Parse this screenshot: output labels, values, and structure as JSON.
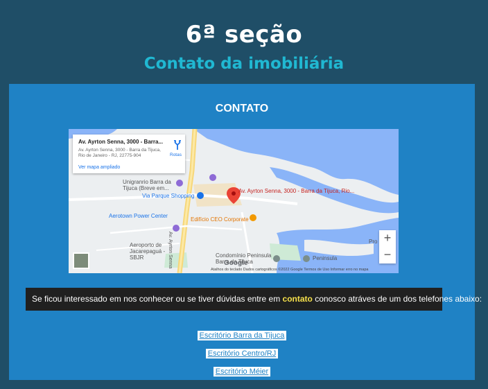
{
  "header": {
    "title": "6ª seção",
    "subtitle": "Contato da imobiliária"
  },
  "panel": {
    "heading": "CONTATO",
    "map": {
      "info_card": {
        "address": "Av. Ayrton Senna, 3000 - Barra...",
        "full_address": "Av. Ayrton Senna, 3000 - Barra da Tijuca, Rio de Janeiro - RJ, 22775-904",
        "larger_map_link": "Ver mapa ampliado",
        "directions_label": "Rotas"
      },
      "labels": {
        "marker_title": "Av. Ayrton Senna, 3000 - Barra da Tijuca, Rio...",
        "unigranrio": "Unigranrio Barra da Tijuca (Breve em...",
        "via_parque": "Via Parque Shopping",
        "aerotown": "Aerotown Power Center",
        "ceo": "Edifício CEO Corporate",
        "aeroporto": "Aeroporto de Jacarepaguá - SBJR",
        "condominio": "Condomínio Peninsula Barra da Tijuca",
        "peninsula": "Peninsula",
        "street": "Av. Ayrton Senna",
        "pro": "Pro",
        "google": "Google"
      },
      "zoom_in": "+",
      "zoom_out": "−",
      "attribution": "Atalhos do teclado    Dados cartográficos ©2022 Google    Termos de Uso    Informar erro no mapa"
    },
    "message": {
      "before": "Se ficou interessado em nos conhecer ou se tiver dúvidas entre em ",
      "highlight": "contato",
      "after": " conosco atráves de um dos telefones abaixo:"
    },
    "links": [
      "Escritório Barra da Tijuca",
      "Escritório Centro/RJ",
      "Escritório Méier"
    ]
  },
  "colors": {
    "background": "#1f4e67",
    "panel": "#1f82c5",
    "subtitle": "#20b8d2",
    "highlight": "#f5e04b",
    "marker": "#ea4335"
  }
}
